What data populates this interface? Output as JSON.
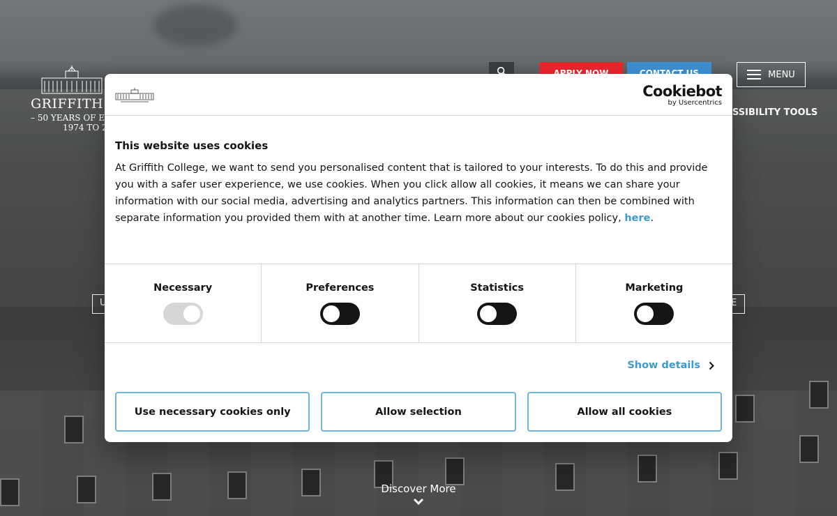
{
  "site": {
    "logo": {
      "name": "GRIFFITH C",
      "tagline_1": "– 50 YEARS OF EX",
      "tagline_2": "1974 TO 2"
    },
    "header": {
      "search_icon": "search-icon",
      "apply_label": "APPLY NOW",
      "contact_label": "CONTACT US",
      "menu_label": "MENU",
      "accessibility_label": "SSIBILITY TOOLS"
    },
    "hero": {
      "side_left": "U",
      "side_right": "E",
      "discover_label": "Discover More"
    },
    "colors": {
      "apply": "#e8262d",
      "contact": "#3d8fd1"
    }
  },
  "cookie_dialog": {
    "brand": "Cookiebot",
    "brand_sub": "by Usercentrics",
    "title": "This website uses cookies",
    "text": "At Griffith College, we want to send you personalised content that is tailored to your interests. To do this and provide you with a safer user experience, we use cookies. When you click allow all cookies, it means we can share your information with our social media, advertising and analytics partners. This information can then be combined with separate information you provided them with at another time. Learn more about our cookies policy, ",
    "link_text": "here",
    "text_end": ".",
    "toggles": [
      {
        "label": "Necessary",
        "state": "on-disabled"
      },
      {
        "label": "Preferences",
        "state": "off"
      },
      {
        "label": "Statistics",
        "state": "off"
      },
      {
        "label": "Marketing",
        "state": "off"
      }
    ],
    "show_details": "Show details",
    "buttons": {
      "necessary": "Use necessary cookies only",
      "selection": "Allow selection",
      "all": "Allow all cookies"
    },
    "colors": {
      "link": "#3b9bd1",
      "button_border": "#6fb4dd",
      "toggle_off": "#141414",
      "toggle_disabled": "#d6d6d6"
    }
  }
}
